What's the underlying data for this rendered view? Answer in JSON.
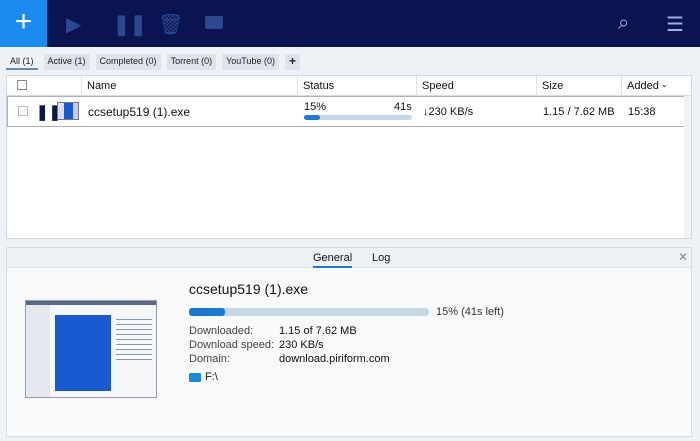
{
  "toolbar": {
    "add": "+",
    "icons": [
      "play-icon",
      "pause-all-icon",
      "trash-icon",
      "folder-icon",
      "search-icon",
      "menu-icon"
    ]
  },
  "filters": [
    {
      "label": "All (1)"
    },
    {
      "label": "Active (1)"
    },
    {
      "label": "Completed (0)"
    },
    {
      "label": "Torrent (0)"
    },
    {
      "label": "YouTube (0)"
    }
  ],
  "add_filter": "+",
  "columns": {
    "name": "Name",
    "status": "Status",
    "speed": "Speed",
    "size": "Size",
    "added": "Added"
  },
  "row": {
    "name": "ccsetup519 (1).exe",
    "percent": "15%",
    "eta": "41s",
    "progress": 15,
    "speed": "↓230 KB/s",
    "size": "1.15 / 7.62 MB",
    "added": "15:38"
  },
  "details": {
    "tabs": [
      "General",
      "Log"
    ],
    "title": "ccsetup519 (1).exe",
    "progress_text": "15% (41s left)",
    "downloaded_label": "Downloaded:",
    "downloaded": "1.15 of 7.62 MB",
    "speed_label": "Download speed:",
    "speed": "230 KB/s",
    "domain_label": "Domain:",
    "domain": "download.piriform.com",
    "folder": "F:\\"
  }
}
